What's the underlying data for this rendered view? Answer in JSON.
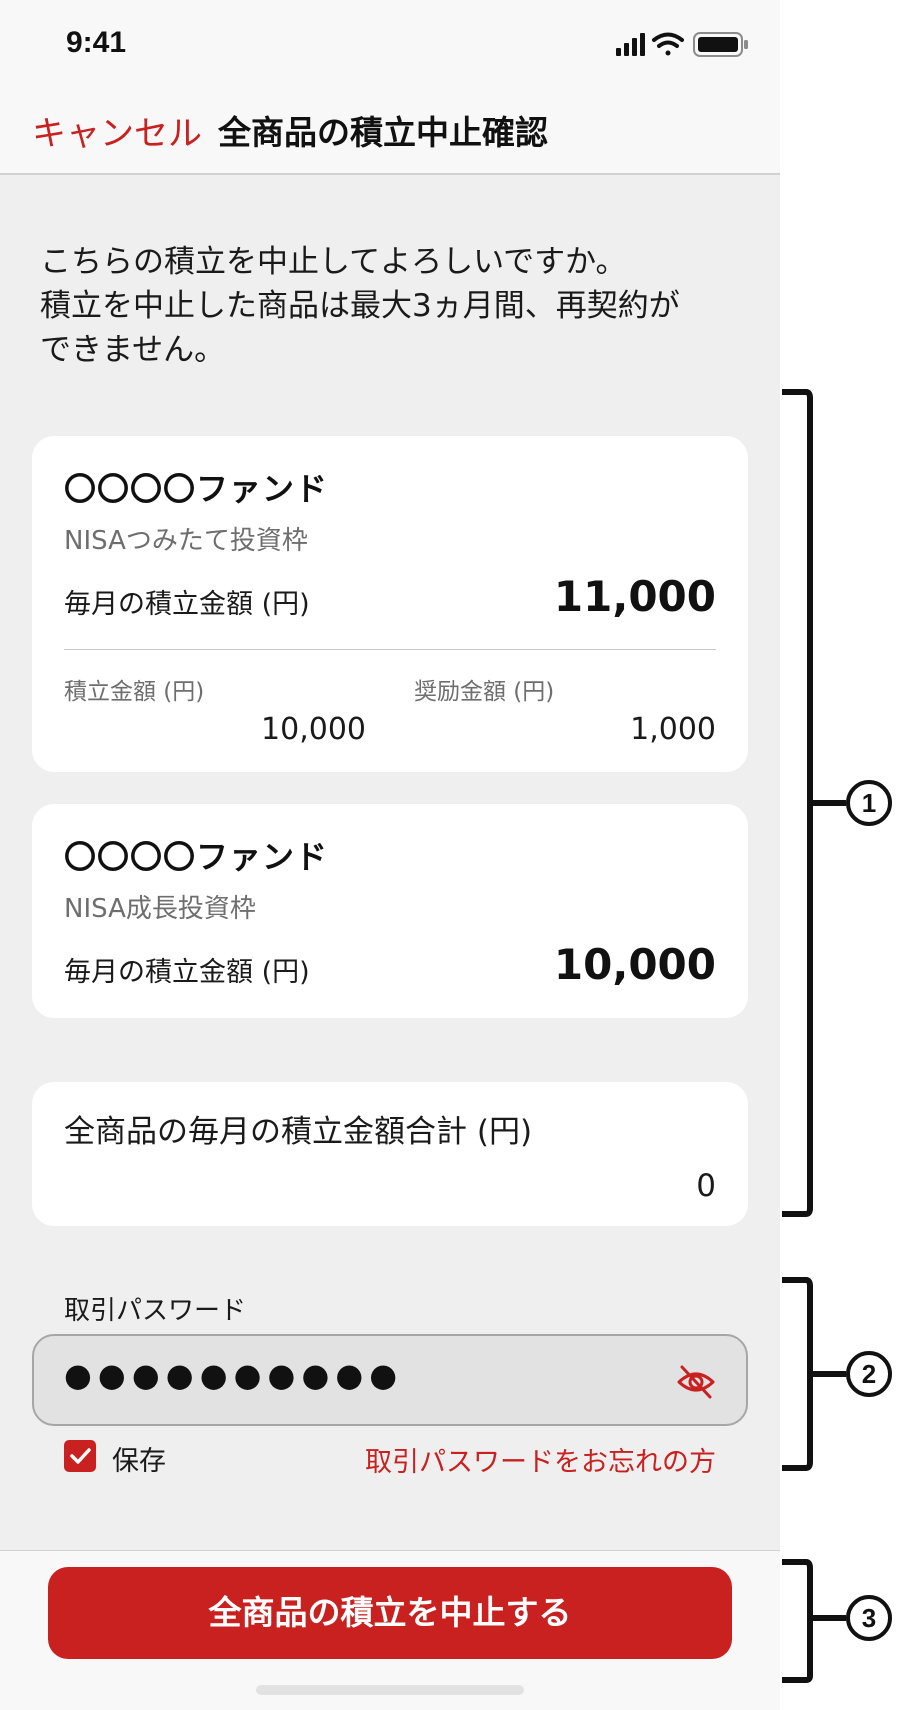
{
  "status_bar": {
    "time": "9:41",
    "icons": [
      "signal-icon",
      "wifi-icon",
      "battery-icon"
    ]
  },
  "nav": {
    "cancel_label": "キャンセル",
    "title": "全商品の積立中止確認"
  },
  "intro": {
    "lines": [
      "こちらの積立を中止してよろしいですか。",
      "積立を中止した商品は最大3ヵ月間、再契約が",
      "できません。"
    ]
  },
  "funds": [
    {
      "name": "〇〇〇〇ファンド",
      "type": "NISAつみたて投資枠",
      "monthly_label": "毎月の積立金額 (円)",
      "monthly_value": "11,000",
      "breakdown": [
        {
          "label": "積立金額 (円)",
          "value": "10,000"
        },
        {
          "label": "奨励金額 (円)",
          "value": "1,000"
        }
      ]
    },
    {
      "name": "〇〇〇〇ファンド",
      "type": "NISA成長投資枠",
      "monthly_label": "毎月の積立金額 (円)",
      "monthly_value": "10,000"
    }
  ],
  "total": {
    "label": "全商品の毎月の積立金額合計 (円)",
    "value": "0"
  },
  "password": {
    "label": "取引パスワード",
    "masked_value": "●●●●●●●●●●",
    "toggle_icon": "eye-off-icon",
    "save_label": "保存",
    "save_checked": true,
    "forgot_link": "取引パスワードをお忘れの方"
  },
  "footer": {
    "submit_label": "全商品の積立を中止する"
  },
  "annotations": {
    "markers": [
      "1",
      "2",
      "3"
    ]
  },
  "colors": {
    "accent": "#c8211f",
    "background": "#efefef",
    "card": "#ffffff",
    "muted_text": "#6e6e6e"
  }
}
